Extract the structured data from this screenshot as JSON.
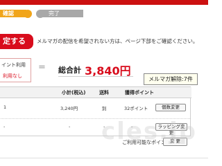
{
  "steps": {
    "confirm_label": "確認",
    "done_label": "完了"
  },
  "action_button_label": "定する",
  "notice_text": "メルマガの配信を希望されない方は、ページ下部をご確認ください。",
  "point_box": {
    "line1": "イント利用",
    "line2": "利用なし"
  },
  "total": {
    "equals_sign": "=",
    "label": "総合計",
    "value": "3,840円"
  },
  "popup_text": "メルマガ解除:7件",
  "table": {
    "headers": [
      "小計(税込)",
      "送料",
      "獲得ポイント"
    ],
    "rows": [
      {
        "index": "1",
        "subtotal": "3,240円",
        "shipping": "別",
        "points": "32ポイント",
        "button": "個数変更"
      },
      {
        "index": "-",
        "subtotal": "-",
        "shipping": "-",
        "points": "-",
        "button": "ラッピング変更"
      }
    ]
  },
  "available_points_label": "ご利用可能なポイント残高:",
  "available_points_masked": "▮▮▮▮▮",
  "change_button_label": "変 更",
  "watermark_text": "cles.jp",
  "colors": {
    "brand_red": "#d80c1c",
    "step_active": "#f1a51a",
    "step_inactive": "#a8a8a8"
  }
}
